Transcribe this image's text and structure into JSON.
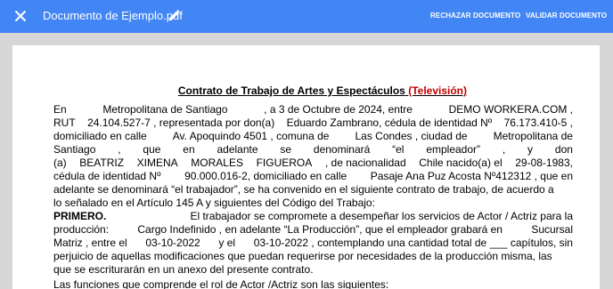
{
  "topbar": {
    "doc_title": "Documento de Ejemplo.pdf",
    "reject_label": "RECHAZAR DOCUMENTO",
    "validate_label": "VALIDAR DOCUMENTO",
    "close_icon": "close-icon",
    "edit_icon": "pencil-icon",
    "bg_color": "#4285f4"
  },
  "document": {
    "heading": "Contrato de Trabajo de Artes y Espectáculos",
    "heading_suffix": "(Televisión)",
    "heading_suffix_color": "#c00000",
    "p1": {
      "l1": [
        "En",
        "Metropolitana de Santiago",
        ", a 3 de Octubre de 2024, entre",
        "DEMO WORKERA.COM ,"
      ],
      "l2": [
        "RUT",
        "24.104.527-7 , representada por don(a)",
        "Eduardo Zambrano, cédula de identidad Nº",
        "76.173.410-5 ,"
      ],
      "l3": [
        "domiciliado en calle",
        "Av. Apoquindo 4501 , comuna de",
        "Las Condes , ciudad de",
        "Metropolitana de"
      ],
      "l4": [
        "Santiago",
        ",",
        "que",
        "en",
        "adelante",
        "se",
        "denominará",
        "“el",
        "empleador”",
        ",",
        "y",
        "don"
      ],
      "l5": [
        "(a)",
        "BEATRIZ",
        "XIMENA",
        "MORALES",
        "FIGUEROA",
        ", de nacionalidad",
        "Chile nacido(a) el",
        "29-08-1983,"
      ],
      "l6": [
        "cédula de identidad Nº",
        "90.000.016-2, domiciliado en calle",
        "Pasaje Ana Puz Acosta Nº412312 , que en"
      ],
      "l7": [
        "adelante se denominará “el trabajador”, se ha convenido en el siguiente contrato de trabajo, de acuerdo a"
      ],
      "l8": "lo señalado en el Artículo 145 A y siguientes del Código del Trabajo:"
    },
    "p2": {
      "lead": "PRIMERO.",
      "l1_rest": [
        "El trabajador se compromete a desempeñar los servicios de Actor / Actriz para la"
      ],
      "l2": [
        "producción:",
        "Cargo Indefinido , en adelante “La Producción”, que el empleador grabará en",
        "Sucursal"
      ],
      "l3": [
        "Matriz , entre el",
        "03-10-2022",
        "y el",
        "03-10-2022 , contemplando una cantidad total de ___ capítulos, sin"
      ],
      "l4": [
        "perjuicio de aquellas modificaciones que puedan requerirse por necesidades de la producción misma, las"
      ],
      "l5": "que se escriturarán en un anexo del presente contrato."
    },
    "p3": "Las funciones que comprende el rol de Actor /Actriz son las siguientes:"
  }
}
